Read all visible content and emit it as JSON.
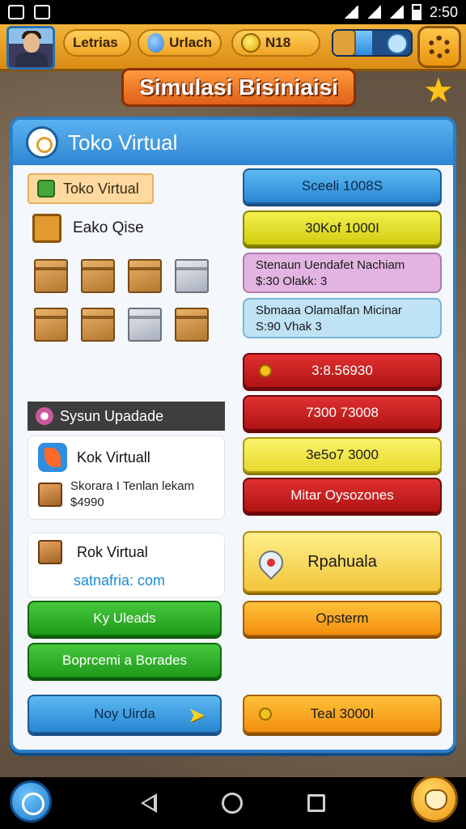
{
  "status_bar": {
    "time": "2:50"
  },
  "top_bar": {
    "resource1": "Letrias",
    "resource2": "Urlach",
    "resource3": "N18",
    "progress_fraction": 0.5
  },
  "banner": {
    "title": "Simulasi Bisiniaisi"
  },
  "panel": {
    "title": "Toko Virtual",
    "tag_label": "Toko Virtual",
    "shop_title": "Eako Qise",
    "system_header": "Sysun Upadade",
    "card1": {
      "title": "Kok Virtuall",
      "line1": "Skorara I Tenlan lekam",
      "line2": "$4990"
    },
    "card2": {
      "title": "Rok Virtual",
      "link": "satnafria: com"
    }
  },
  "right_buttons": {
    "b1": "Sceeli 1008S",
    "b2": "30Kof 1000I",
    "b3_line1": "Stenaun Uendafet Nachiam",
    "b3_line2": "$:30 Olakk: 3",
    "b4_line1": "Sbmaaa Olamalfan Micinar",
    "b4_line2": "S:90 Vhak 3",
    "b5": "3:8.56930",
    "b6": "7300 73008",
    "b7": "3e5o7 3000",
    "b8": "Mitar Oysozones",
    "b9": "Rpahuala",
    "b10": "Opsterm",
    "b11": "Teal 3000I"
  },
  "left_buttons": {
    "green1": "Ky Uleads",
    "green2": "Boprcemi a Borades",
    "blue": "Noy Uirda"
  },
  "colors": {
    "accent_blue": "#2a7fc8",
    "accent_orange": "#e0601a"
  }
}
